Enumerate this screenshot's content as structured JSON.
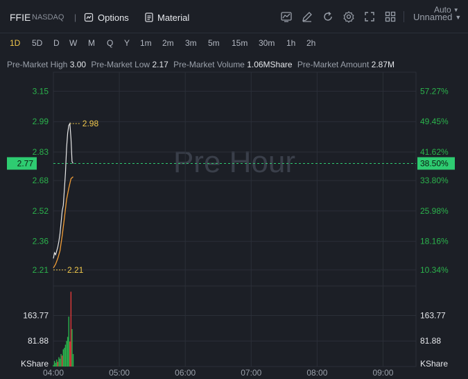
{
  "header": {
    "ticker": "FFIE",
    "exchange": "NASDAQ",
    "options_label": "Options",
    "material_label": "Material",
    "layout_name": "Unnamed"
  },
  "periods": [
    "1D",
    "5D",
    "D",
    "W",
    "M",
    "Q",
    "Y",
    "1m",
    "2m",
    "3m",
    "5m",
    "15m",
    "30m",
    "1h",
    "2h"
  ],
  "active_period": "1D",
  "scale_mode": "Auto",
  "stats": {
    "high_label": "Pre-Market High",
    "high_value": "3.00",
    "low_label": "Pre-Market Low",
    "low_value": "2.17",
    "volume_label": "Pre-Market Volume",
    "volume_value": "1.06MShare",
    "amount_label": "Pre-Market Amount",
    "amount_value": "2.87M"
  },
  "watermark": "Pre Hour",
  "colors": {
    "up": "#2bb24c",
    "down": "#e03a3a",
    "accent": "#f2c94c",
    "current": "#2ecc71",
    "price_line": "#e8e8e8",
    "avg_line": "#f29e38"
  },
  "chart_data": {
    "type": "line",
    "price_ticks": [
      "3.15",
      "2.99",
      "2.83",
      "2.68",
      "2.52",
      "2.36",
      "2.21"
    ],
    "pct_ticks": [
      "57.27%",
      "49.45%",
      "41.62%",
      "33.80%",
      "25.98%",
      "18.16%",
      "10.34%"
    ],
    "current_price": "2.77",
    "current_pct": "38.50%",
    "high_marker": "2.98",
    "low_marker": "2.21",
    "x_ticks": [
      "04:00",
      "05:00",
      "06:00",
      "07:00",
      "08:00",
      "09:00"
    ],
    "volume_ticks": [
      "163.77",
      "81.88"
    ],
    "volume_unit": "KShare",
    "ylim": [
      2.14,
      3.25
    ],
    "xlim_minutes": [
      0,
      330
    ],
    "price_series": [
      [
        0,
        2.27
      ],
      [
        1,
        2.3
      ],
      [
        2,
        2.29
      ],
      [
        3,
        2.31
      ],
      [
        4,
        2.33
      ],
      [
        5,
        2.36
      ],
      [
        6,
        2.4
      ],
      [
        7,
        2.46
      ],
      [
        8,
        2.52
      ],
      [
        9,
        2.55
      ],
      [
        10,
        2.63
      ],
      [
        11,
        2.72
      ],
      [
        12,
        2.85
      ],
      [
        13,
        2.93
      ],
      [
        14,
        2.97
      ],
      [
        15,
        2.98
      ],
      [
        16,
        2.9
      ],
      [
        17,
        2.78
      ],
      [
        18,
        2.77
      ]
    ],
    "avg_series": [
      [
        0,
        2.22
      ],
      [
        2,
        2.24
      ],
      [
        4,
        2.27
      ],
      [
        6,
        2.31
      ],
      [
        8,
        2.39
      ],
      [
        10,
        2.48
      ],
      [
        12,
        2.58
      ],
      [
        14,
        2.64
      ],
      [
        16,
        2.69
      ],
      [
        18,
        2.7
      ]
    ],
    "volume_max": 245,
    "volume_series": [
      {
        "t": 0,
        "v": 5,
        "up": true
      },
      {
        "t": 1,
        "v": 18,
        "up": true
      },
      {
        "t": 2,
        "v": 12,
        "up": true
      },
      {
        "t": 3,
        "v": 22,
        "up": true
      },
      {
        "t": 4,
        "v": 15,
        "up": false
      },
      {
        "t": 5,
        "v": 30,
        "up": true
      },
      {
        "t": 6,
        "v": 25,
        "up": true
      },
      {
        "t": 7,
        "v": 40,
        "up": true
      },
      {
        "t": 8,
        "v": 35,
        "up": false
      },
      {
        "t": 9,
        "v": 55,
        "up": true
      },
      {
        "t": 10,
        "v": 60,
        "up": true
      },
      {
        "t": 11,
        "v": 70,
        "up": true
      },
      {
        "t": 12,
        "v": 82,
        "up": true
      },
      {
        "t": 13,
        "v": 95,
        "up": true
      },
      {
        "t": 14,
        "v": 160,
        "up": true
      },
      {
        "t": 15,
        "v": 80,
        "up": false
      },
      {
        "t": 16,
        "v": 240,
        "up": false
      },
      {
        "t": 17,
        "v": 120,
        "up": true
      },
      {
        "t": 18,
        "v": 40,
        "up": true
      }
    ]
  }
}
